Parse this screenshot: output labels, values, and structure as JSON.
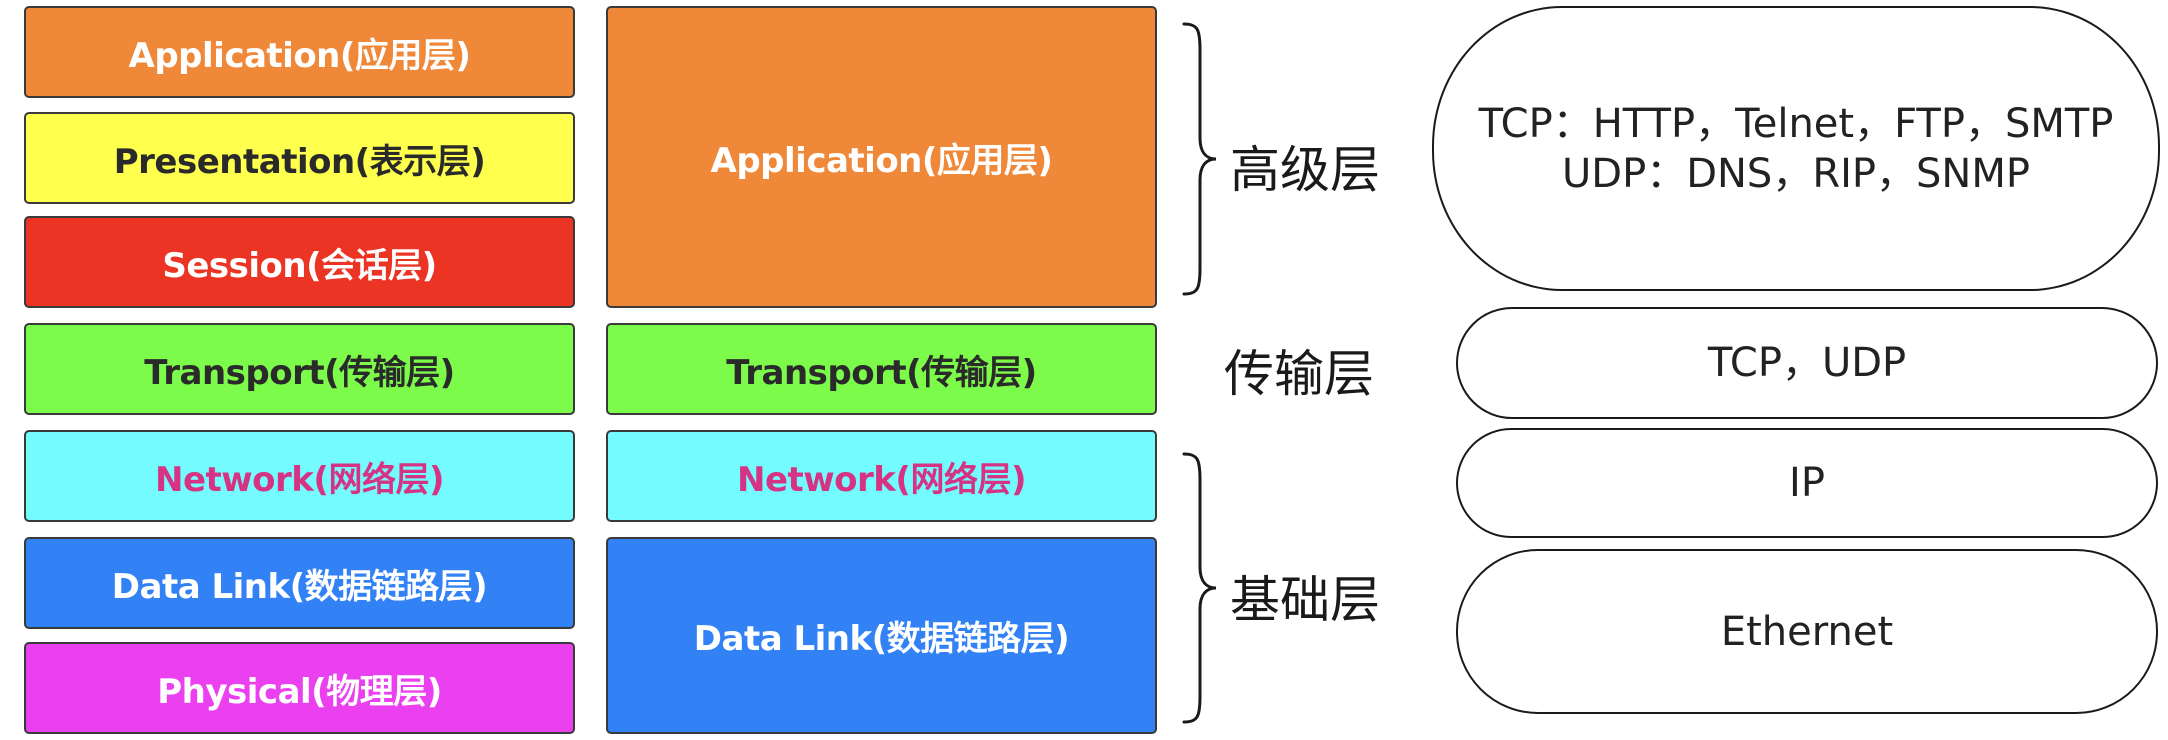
{
  "osi_column": [
    {
      "label": "Application(应用层)",
      "bg": "#F0883A",
      "fg": "#ffffff"
    },
    {
      "label": "Presentation(表示层)",
      "bg": "#FFFF4D",
      "fg": "#2a2a2a"
    },
    {
      "label": "Session(会话层)",
      "bg": "#EC3424",
      "fg": "#ffffff"
    },
    {
      "label": "Transport(传输层)",
      "bg": "#7CFB4A",
      "fg": "#2a2a2a"
    },
    {
      "label": "Network(网络层)",
      "bg": "#73FBFD",
      "fg": "#D63384"
    },
    {
      "label": "Data Link(数据链路层)",
      "bg": "#3282F6",
      "fg": "#ffffff"
    },
    {
      "label": "Physical(物理层)",
      "bg": "#EA40F0",
      "fg": "#ffffff"
    }
  ],
  "tcpip_column": [
    {
      "label": "Application(应用层)",
      "bg": "#F0883A",
      "fg": "#ffffff"
    },
    {
      "label": "Transport(传输层)",
      "bg": "#7CFB4A",
      "fg": "#2a2a2a"
    },
    {
      "label": "Network(网络层)",
      "bg": "#73FBFD",
      "fg": "#D63384"
    },
    {
      "label": "Data Link(数据链路层)",
      "bg": "#3282F6",
      "fg": "#ffffff"
    }
  ],
  "group_labels": {
    "high": "高级层",
    "transport": "传输层",
    "base": "基础层"
  },
  "protocols": {
    "app_line1": "TCP：HTTP，Telnet，FTP，SMTP",
    "app_line2": "UDP：DNS，RIP，SNMP",
    "transport": "TCP，UDP",
    "network": "IP",
    "link": "Ethernet"
  }
}
